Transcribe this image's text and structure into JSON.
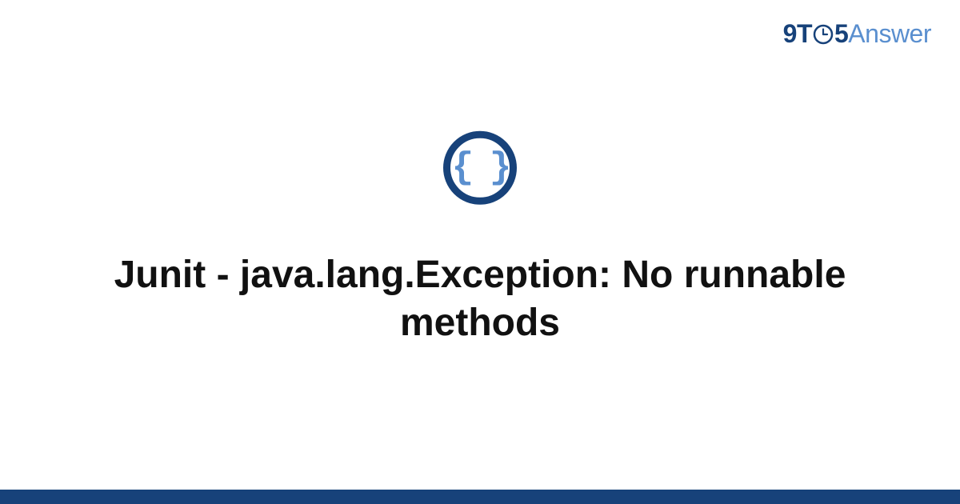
{
  "logo": {
    "part1": "9T",
    "part2": "5",
    "part3": "Answer"
  },
  "icon": {
    "braces": "{ }",
    "name": "code-braces-icon"
  },
  "title": "Junit - java.lang.Exception: No runnable methods",
  "colors": {
    "brand_dark": "#17427a",
    "brand_light": "#5a8fcf",
    "text": "#111111",
    "background": "#ffffff"
  }
}
